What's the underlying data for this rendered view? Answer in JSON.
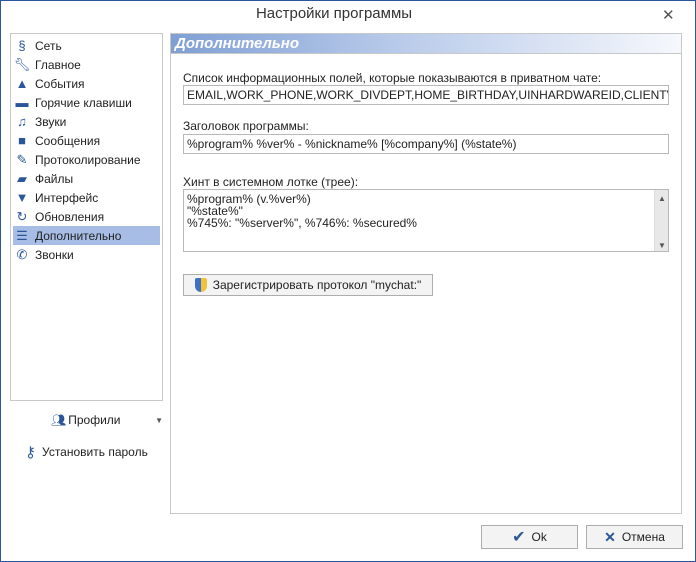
{
  "window": {
    "title": "Настройки программы",
    "close_icon": "close-icon"
  },
  "sidebar": {
    "items": [
      {
        "label": "Сеть",
        "icon": "network-icon"
      },
      {
        "label": "Главное",
        "icon": "wrench-icon"
      },
      {
        "label": "События",
        "icon": "bell-icon"
      },
      {
        "label": "Горячие клавиши",
        "icon": "keyboard-icon"
      },
      {
        "label": "Звуки",
        "icon": "music-icon"
      },
      {
        "label": "Сообщения",
        "icon": "message-icon"
      },
      {
        "label": "Протоколирование",
        "icon": "pencil-icon"
      },
      {
        "label": "Файлы",
        "icon": "folder-icon"
      },
      {
        "label": "Интерфейс",
        "icon": "shirt-icon"
      },
      {
        "label": "Обновления",
        "icon": "refresh-icon"
      },
      {
        "label": "Дополнительно",
        "icon": "server-icon",
        "selected": true
      },
      {
        "label": "Звонки",
        "icon": "phone-icon"
      }
    ],
    "profiles_label": "Профили",
    "set_password_label": "Установить пароль"
  },
  "main": {
    "header": "Дополнительно",
    "fields_label": "Список информационных полей, которые показываются в приватном чате:",
    "fields_value": "EMAIL,WORK_PHONE,WORK_DIVDEPT,HOME_BIRTHDAY,UINHARDWAREID,CLIENTVERSION,HOME",
    "title_label": "Заголовок программы:",
    "title_value": "%program% %ver% - %nickname% [%company%] (%state%)",
    "hint_label": "Хинт в системном лотке (трее):",
    "hint_value": "%program% (v.%ver%)\n\"%state%\"\n%745%: \"%server%\", %746%: %secured%",
    "register_label": "Зарегистрировать протокол \"mychat:\""
  },
  "footer": {
    "ok_label": "Ok",
    "cancel_label": "Отмена"
  },
  "colors": {
    "accent": "#2b579a",
    "selection": "#a7bde6"
  }
}
